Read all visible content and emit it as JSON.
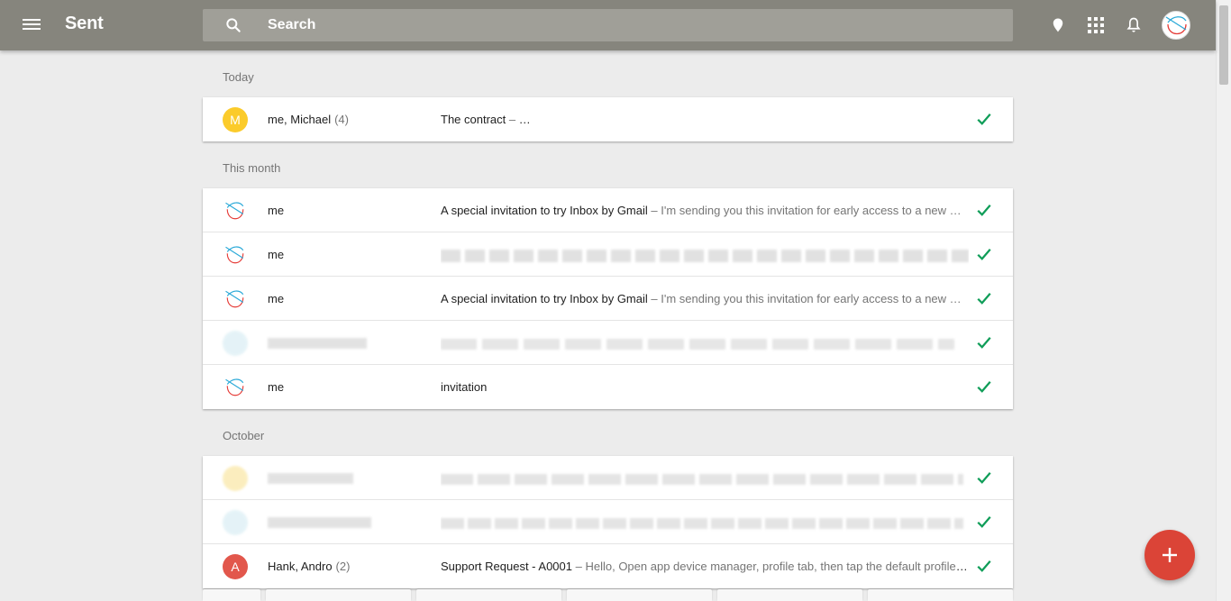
{
  "header": {
    "title": "Sent",
    "search_placeholder": "Search",
    "icons": [
      "menu-icon",
      "search-icon",
      "reminder-icon",
      "apps-icon",
      "notifications-icon",
      "account-avatar"
    ]
  },
  "colors": {
    "topbar": "#86857d",
    "fab": "#db4437",
    "check": "#0f9d58",
    "avatar_m": "#fbcb2b",
    "avatar_a": "#e2574c"
  },
  "sections": [
    {
      "label": "Today",
      "rows": [
        {
          "avatar_letter": "M",
          "avatar_color": "#fbcb2b",
          "sender": "me, Michael",
          "count": "(4)",
          "subject": "The contract",
          "snippet": ""
        }
      ]
    },
    {
      "label": "This month",
      "rows": [
        {
          "avatar_letter": "",
          "sender": "me",
          "count": "",
          "subject": "A special invitation to try Inbox by Gmail",
          "snippet": "I'm sending you this invitation for early access to a new …"
        },
        {
          "avatar_letter": "",
          "sender": "me",
          "count": "",
          "subject": "",
          "snippet": ""
        },
        {
          "avatar_letter": "",
          "sender": "me",
          "count": "",
          "subject": "A special invitation to try Inbox by Gmail",
          "snippet": "I'm sending you this invitation for early access to a new …"
        },
        {
          "avatar_letter": "",
          "sender": "",
          "count": "",
          "subject": "",
          "snippet": ""
        },
        {
          "avatar_letter": "",
          "sender": "me",
          "count": "",
          "subject": "invitation",
          "snippet": ""
        }
      ]
    },
    {
      "label": "October",
      "rows": [
        {
          "avatar_letter": "",
          "sender": "",
          "count": "",
          "subject": "",
          "snippet": ""
        },
        {
          "avatar_letter": "",
          "sender": "",
          "count": "",
          "subject": "",
          "snippet": ""
        },
        {
          "avatar_letter": "A",
          "avatar_color": "#e2574c",
          "sender": "Hank, Andro",
          "count": "(2)",
          "subject": "Support Request - A0001",
          "snippet": "Hello, Open app device manager, profile tab, then tap the default profile …"
        }
      ]
    }
  ],
  "fab_label": "+"
}
